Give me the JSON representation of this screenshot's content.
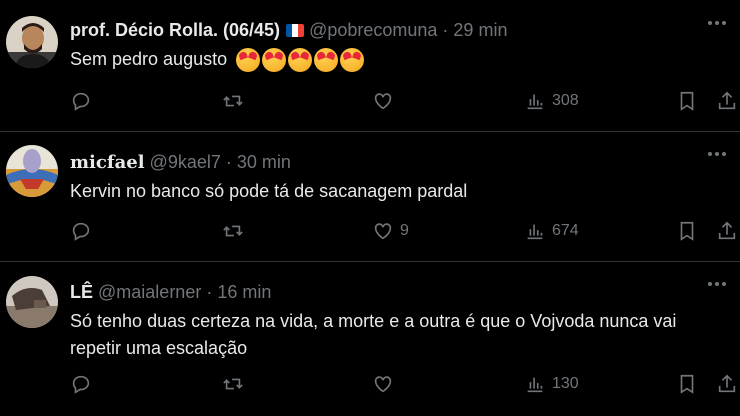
{
  "tweets": [
    {
      "name": "prof. Décio Rolla. (06/45)",
      "handle": "@pobrecomuna",
      "separator": "·",
      "time": "29 min",
      "text": "Sem pedro augusto",
      "emoji_count": 5,
      "likes": "",
      "views": "308"
    },
    {
      "name": "micfael",
      "handle": "@9kael7",
      "separator": "·",
      "time": "30 min",
      "text": "Kervin no banco só pode tá de sacanagem pardal",
      "likes": "9",
      "views": "674"
    },
    {
      "name": "LÊ",
      "handle": "@maialerner",
      "separator": "·",
      "time": "16 min",
      "text": "Só tenho duas certeza na vida, a morte e a outra é que o Vojvoda nunca vai repetir uma escalação",
      "likes": "",
      "views": "130"
    }
  ],
  "colors": {
    "background": "#000000",
    "text": "#e7e9ea",
    "muted": "#71767b",
    "border": "#2f3336"
  },
  "icons": [
    "reply-icon",
    "retweet-icon",
    "like-icon",
    "views-icon",
    "bookmark-icon",
    "share-icon",
    "more-icon",
    "france-flag-icon"
  ]
}
